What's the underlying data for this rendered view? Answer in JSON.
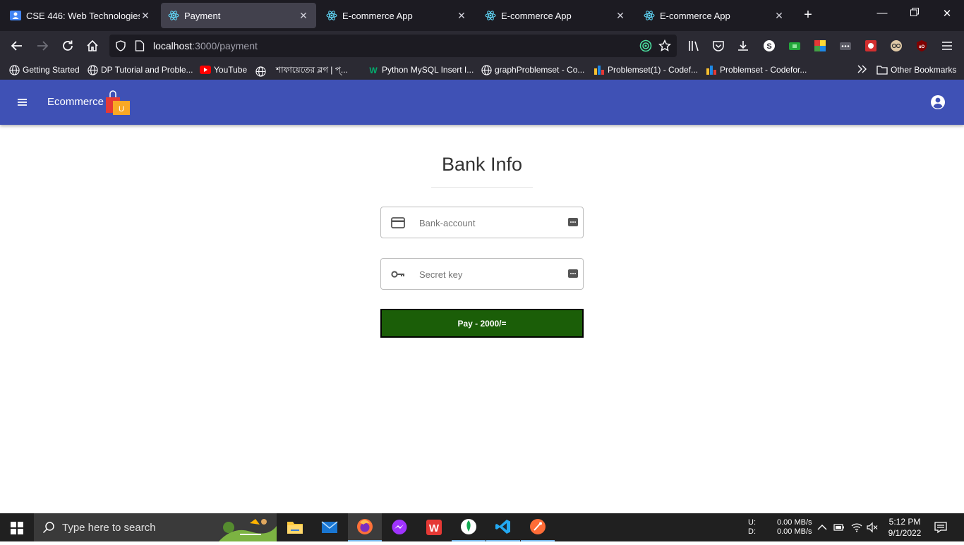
{
  "browser": {
    "tabs": [
      {
        "title": "CSE 446: Web Technologies",
        "icon": "classroom-icon",
        "active": false
      },
      {
        "title": "Payment",
        "icon": "react-icon",
        "active": true
      },
      {
        "title": "E-commerce App",
        "icon": "react-icon",
        "active": false
      },
      {
        "title": "E-commerce App",
        "icon": "react-icon",
        "active": false
      },
      {
        "title": "E-commerce App",
        "icon": "react-icon",
        "active": false
      }
    ],
    "url_host": "localhost",
    "url_rest": ":3000/payment",
    "bookmarks": [
      {
        "label": "Getting Started",
        "icon": "globe-icon"
      },
      {
        "label": "DP Tutorial and Proble...",
        "icon": "globe-icon"
      },
      {
        "label": "YouTube",
        "icon": "youtube-icon"
      },
      {
        "label": "শাফায়েতের ব্লগ | প্...",
        "icon": "globe-icon"
      },
      {
        "label": "Python MySQL Insert I...",
        "icon": "w3schools-icon"
      },
      {
        "label": "graphProblemset - Co...",
        "icon": "globe-icon"
      },
      {
        "label": "Problemset(1) - Codef...",
        "icon": "codeforces-icon"
      },
      {
        "label": "Problemset - Codefor...",
        "icon": "codeforces-icon"
      }
    ],
    "other_bookmarks": "Other Bookmarks"
  },
  "app": {
    "brand": "Ecommerce",
    "logo_letter": "U",
    "accent": "#3f51b5",
    "title": "Bank Info",
    "bank_account_placeholder": "Bank-account",
    "secret_key_placeholder": "Secret key",
    "pay_label": "Pay - 2000/=",
    "pay_color": "#1b5e08"
  },
  "taskbar": {
    "search_placeholder": "Type here to search",
    "upload_label": "U:",
    "download_label": "D:",
    "upload_speed": "0.00 MB/s",
    "download_speed": "0.00 MB/s",
    "time": "5:12 PM",
    "date": "9/1/2022"
  }
}
